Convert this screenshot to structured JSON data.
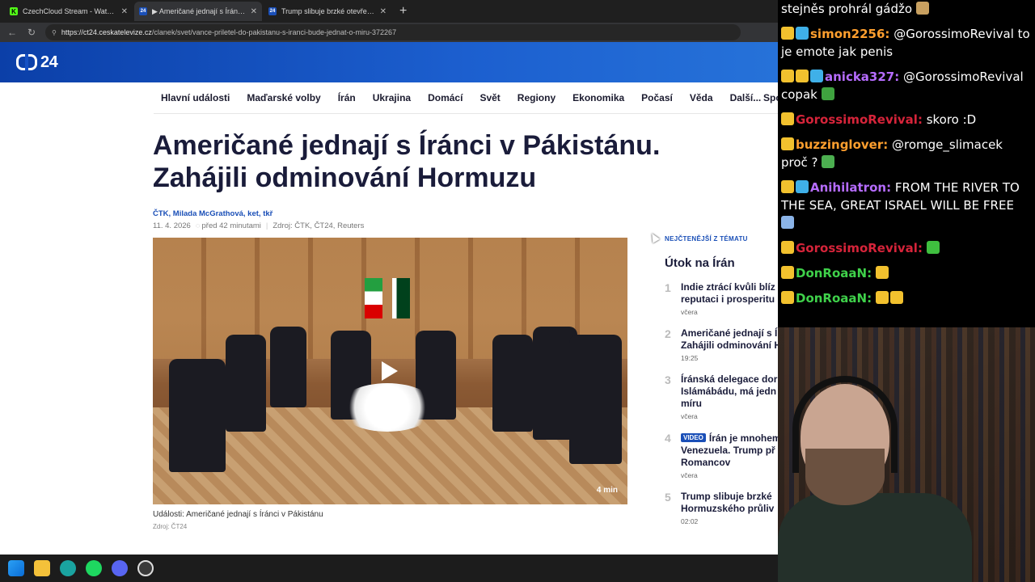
{
  "browser": {
    "tabs": [
      {
        "title": "CzechCloud Stream - Watch Live o",
        "close": "✕",
        "fav": "K",
        "fav_color": "#53fc18",
        "active": false
      },
      {
        "title": "▶ Američané jednají s Íránci v Páki",
        "close": "✕",
        "fav": "24",
        "fav_color": "#1a4fb7",
        "active": true
      },
      {
        "title": "Trump slibuje brzké otevření Horm",
        "close": "✕",
        "fav": "24",
        "fav_color": "#1a4fb7",
        "active": false
      }
    ],
    "new_tab": "+",
    "url_host": "https://ct24.ceskatelevize.cz",
    "url_path": "/clanek/svet/vance-priletel-do-pakistanu-s-iranci-bude-jednat-o-miru-372267"
  },
  "site": {
    "logo_text": "24",
    "menu": [
      "Hlavní události",
      "Maďarské volby",
      "Írán",
      "Ukrajina",
      "Domácí",
      "Svět",
      "Regiony",
      "Ekonomika",
      "Počasí",
      "Věda",
      "Další..."
    ],
    "menu_sport": "Spo"
  },
  "article": {
    "headline": "Američané jednají s Íránci v Pákistánu. Zahájili odminování Hormuzu",
    "authors": "ČTK, Milada McGrathová, ket, tkř",
    "date": "11. 4. 2026",
    "ago": "před 42 minutami",
    "source": "Zdroj: ČTK, ČT24, Reuters",
    "video_duration": "4 min",
    "caption": "Události: Američané jednají s Íránci v Pákistánu",
    "caption_source": "Zdroj: ČT24"
  },
  "sidebar": {
    "label": "NEJČTENĚJŠÍ Z TÉMATU",
    "title": "Útok na Írán",
    "items": [
      {
        "num": "1",
        "line1": "Indie ztrácí kvůli blíz",
        "line2": "reputaci i prosperitu",
        "line3": "",
        "badge": "",
        "time": "včera"
      },
      {
        "num": "2",
        "line1": "Američané jednají s Í",
        "line2": "Zahájili odminování H",
        "line3": "",
        "badge": "",
        "time": "19:25"
      },
      {
        "num": "3",
        "line1": "Íránská delegace dor",
        "line2": "Islámábádu, má jedn",
        "line3": "míru",
        "badge": "",
        "time": "včera"
      },
      {
        "num": "4",
        "line1": "Írán je mnohem",
        "line2": "Venezuela. Trump př",
        "line3": "Romancov",
        "badge": "VIDEO",
        "time": "včera"
      },
      {
        "num": "5",
        "line1": "Trump slibuje brzké",
        "line2": "Hormuzského průliv",
        "line3": "",
        "badge": "",
        "time": "02:02"
      }
    ]
  },
  "chat": {
    "messages": [
      {
        "user": "",
        "color": "#ffffff",
        "text": "stejněs prohrál gádžo",
        "emoji_color": "#c8a060"
      },
      {
        "user": "simon2256:",
        "color": "#ff9f2e",
        "text": " @GorossimoRevival to je emote jak penis",
        "emoji_color": ""
      },
      {
        "user": "anicka327:",
        "color": "#b66cff",
        "text": " @GorossimoRevival copak",
        "emoji_color": "#3fa33f"
      },
      {
        "user": "GorossimoRevival:",
        "color": "#d6243a",
        "text": " skoro :D",
        "emoji_color": ""
      },
      {
        "user": "buzzinglover:",
        "color": "#ff9f2e",
        "text": " @romge_slimacek proč ?",
        "emoji_color": "#4caf50"
      },
      {
        "user": "Anihilatron:",
        "color": "#b66cff",
        "text": " FROM THE RIVER TO THE SEA, GREAT ISRAEL WILL BE FREE",
        "emoji_color": "#8bb4e8"
      },
      {
        "user": "GorossimoRevival:",
        "color": "#d6243a",
        "text": " ",
        "emoji_color": "#3fbf3f"
      },
      {
        "user": "DonRoaaN:",
        "color": "#3fd14a",
        "text": " ",
        "emoji_color": "#f2c12e"
      },
      {
        "user": "DonRoaaN:",
        "color": "#3fd14a",
        "text": " ",
        "emoji_color": "#f2c12e"
      }
    ]
  },
  "taskbar": {
    "icons": [
      "windows-start-icon",
      "file-explorer-icon",
      "edge-icon",
      "spotify-icon",
      "discord-icon",
      "obs-icon"
    ]
  }
}
